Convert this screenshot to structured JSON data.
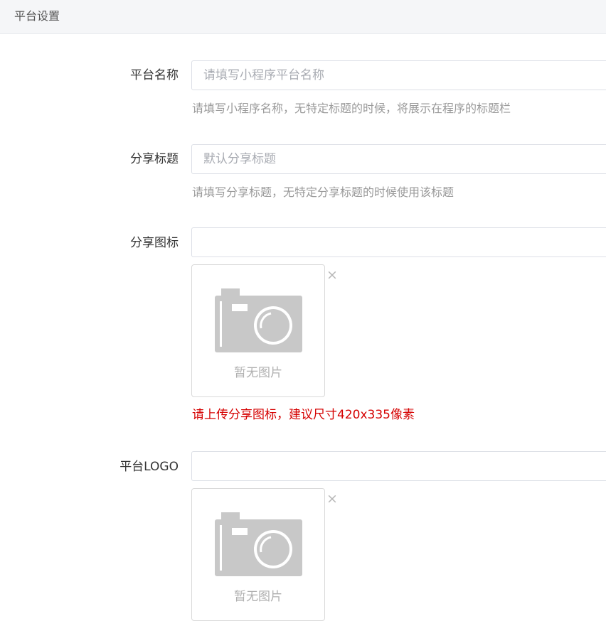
{
  "header": {
    "title": "平台设置"
  },
  "form": {
    "platform_name": {
      "label": "平台名称",
      "placeholder": "请填写小程序平台名称",
      "value": "",
      "help": "请填写小程序名称，无特定标题的时候，将展示在程序的标题栏"
    },
    "share_title": {
      "label": "分享标题",
      "placeholder": "默认分享标题",
      "value": "",
      "help": "请填写分享标题，无特定分享标题的时候使用该标题"
    },
    "share_icon": {
      "label": "分享图标",
      "value": "",
      "empty_text": "暂无图片",
      "remove_icon": "×",
      "help": "请上传分享图标，建议尺寸420x335像素",
      "help_color": "#d50000"
    },
    "platform_logo": {
      "label": "平台LOGO",
      "value": "",
      "empty_text": "暂无图片",
      "remove_icon": "×"
    }
  },
  "icons": {
    "placeholder_image": "camera-icon",
    "remove": "close-icon"
  }
}
